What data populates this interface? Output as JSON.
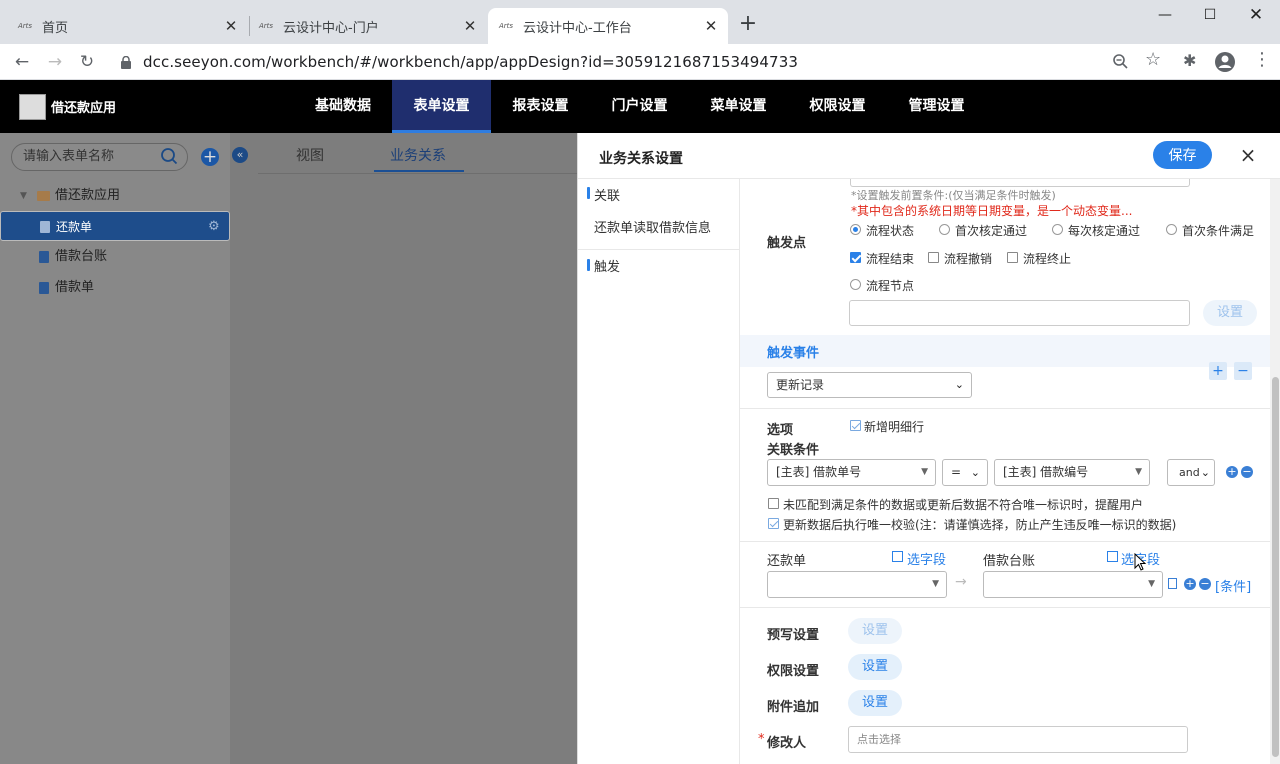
{
  "browser": {
    "tabs": [
      {
        "title": "首页",
        "favicon": "seeyon-favicon"
      },
      {
        "title": "云设计中心-门户",
        "favicon": "seeyon-favicon"
      },
      {
        "title": "云设计中心-工作台",
        "favicon": "seeyon-favicon",
        "active": true
      }
    ],
    "url": "dcc.seeyon.com/workbench/#/workbench/app/appDesign?id=3059121687153494733",
    "favicon_text": "Arts"
  },
  "app": {
    "name": "借还款应用",
    "nav": [
      "基础数据",
      "表单设置",
      "报表设置",
      "门户设置",
      "菜单设置",
      "权限设置",
      "管理设置"
    ],
    "active_nav": "表单设置",
    "accent_color": "#2a81e8"
  },
  "left_panel": {
    "search_placeholder": "请输入表单名称",
    "tree": {
      "root": "借还款应用",
      "items": [
        "还款单",
        "借款台账",
        "借款单"
      ],
      "selected": "还款单"
    }
  },
  "mid_tabs": [
    "视图",
    "业务关系"
  ],
  "drawer": {
    "title": "业务关系设置",
    "save_label": "保存",
    "close_glyph": "×",
    "nav": {
      "section1": "关联",
      "item1": "还款单读取借款信息",
      "section2": "触发"
    },
    "hint_small": "*设置触发前置条件:(仅当满足条件时触发)",
    "hint_red": "*其中包含的系统日期等日期变量，是一个动态变量...",
    "trigger": {
      "label": "触发点",
      "radios": [
        "流程状态",
        "首次核定通过",
        "每次核定通过",
        "首次条件满足"
      ],
      "checks": [
        "流程结束",
        "流程撤销",
        "流程终止"
      ],
      "node_radio": "流程节点",
      "set_label": "设置"
    },
    "event": {
      "label": "触发事件",
      "value": "更新记录"
    },
    "options": {
      "label": "选项",
      "check": "新增明细行"
    },
    "conditions": {
      "label": "关联条件",
      "left": "[主表] 借款单号",
      "op": "=",
      "right": "[主表] 借款编号",
      "logic": "and",
      "check1": "未匹配到满足条件的数据或更新后数据不符合唯一标识时，提醒用户",
      "check2": "更新数据后执行唯一校验(注：请谨慎选择，防止产生违反唯一标识的数据)"
    },
    "mapping": {
      "left_form": "还款单",
      "right_form": "借款台账",
      "pick_field": "选字段",
      "condition_link": "[条件]"
    },
    "settings": [
      {
        "label": "预写设置",
        "button": "设置",
        "disabled": true
      },
      {
        "label": "权限设置",
        "button": "设置"
      },
      {
        "label": "附件追加",
        "button": "设置"
      }
    ],
    "modifier": {
      "label": "修改人",
      "required": "*",
      "placeholder": "点击选择"
    }
  }
}
